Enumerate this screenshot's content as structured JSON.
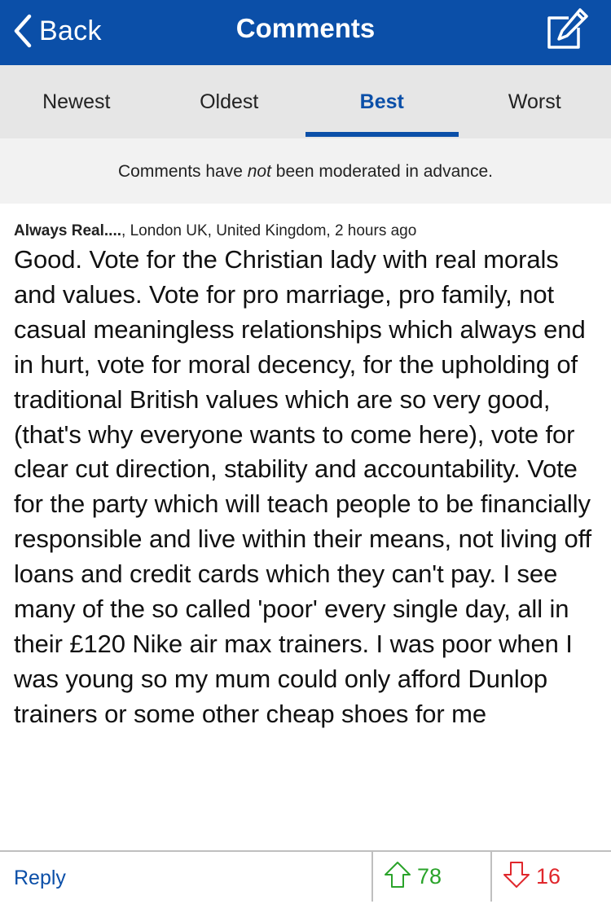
{
  "navbar": {
    "back_label": "Back",
    "title": "Comments"
  },
  "tabs": [
    {
      "label": "Newest",
      "active": false
    },
    {
      "label": "Oldest",
      "active": false
    },
    {
      "label": "Best",
      "active": true
    },
    {
      "label": "Worst",
      "active": false
    }
  ],
  "notice": {
    "before": "Comments have ",
    "emphasis": "not",
    "after": " been moderated in advance."
  },
  "comment": {
    "author": "Always Real....",
    "location_time": ", London UK, United Kingdom, 2 hours ago",
    "body": "Good. Vote for the Christian lady with real morals and values. Vote for pro marriage, pro family, not casual meaningless relationships which always end in hurt, vote for moral decency, for the upholding of traditional British values which are so very good, (that's why everyone wants to come here), vote for clear cut direction, stability and accountability. Vote for the party which will teach people to be financially responsible and live within their means, not living off loans and credit cards which they can't pay. I see many of the so called 'poor' every single day, all in their £120 Nike air max trainers. I was poor when I was young so my mum could only afford Dunlop trainers or some other cheap shoes for me",
    "reply_label": "Reply",
    "upvotes": "78",
    "downvotes": "16"
  },
  "colors": {
    "accent": "#0b4fa8",
    "upvote": "#2aa32a",
    "downvote": "#e0272c"
  }
}
